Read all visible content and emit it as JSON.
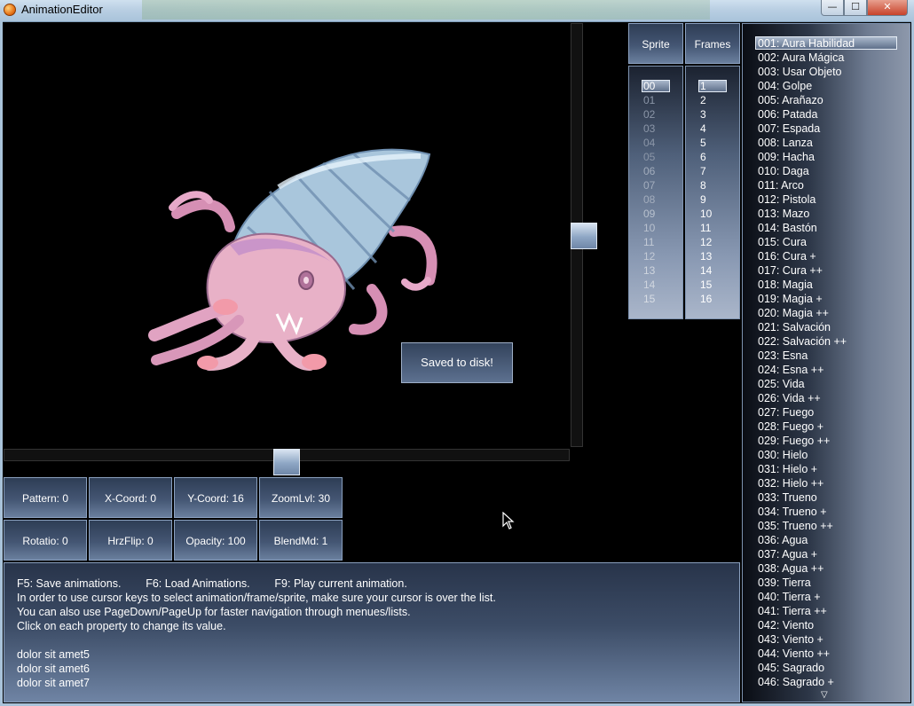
{
  "window": {
    "title": "AnimationEditor",
    "buttons": {
      "minimize": "—",
      "maximize": "☐",
      "close": "✕"
    }
  },
  "popup": {
    "message": "Saved to disk!"
  },
  "column_headers": {
    "sprite": "Sprite",
    "frames": "Frames"
  },
  "sprite_list": {
    "selected": "00",
    "items": [
      "00",
      "01",
      "02",
      "03",
      "04",
      "05",
      "06",
      "07",
      "08",
      "09",
      "10",
      "11",
      "12",
      "13",
      "14",
      "15"
    ]
  },
  "frame_list": {
    "selected": "1",
    "items": [
      "1",
      "2",
      "3",
      "4",
      "5",
      "6",
      "7",
      "8",
      "9",
      "10",
      "11",
      "12",
      "13",
      "14",
      "15",
      "16"
    ]
  },
  "properties": {
    "pattern": "Pattern: 0",
    "x_coord": "X-Coord: 0",
    "y_coord": "Y-Coord: 16",
    "zoom": "ZoomLvl: 30",
    "rotation": "Rotatio: 0",
    "hrz_flip": "HrzFlip: 0",
    "opacity": "Opacity: 100",
    "blend": "BlendMd: 1"
  },
  "info": {
    "line1": "F5: Save animations.        F6: Load Animations.        F9: Play current animation.",
    "line2": "In order to use cursor keys to select animation/frame/sprite, make sure your cursor is over the list.",
    "line3": "You can also use PageDown/PageUp for faster navigation through menues/lists.",
    "line4": "Click on each property to change its value.",
    "line5": "dolor sit amet5",
    "line6": "dolor sit amet6",
    "line7": "dolor sit amet7"
  },
  "animations": {
    "selected": "001: Aura Habilidad",
    "items": [
      "001: Aura Habilidad",
      "002: Aura Mágica",
      "003: Usar Objeto",
      "004: Golpe",
      "005: Arañazo",
      "006: Patada",
      "007: Espada",
      "008: Lanza",
      "009: Hacha",
      "010: Daga",
      "011: Arco",
      "012: Pistola",
      "013: Mazo",
      "014: Bastón",
      "015: Cura",
      "016: Cura +",
      "017: Cura ++",
      "018: Magia",
      "019: Magia +",
      "020: Magia ++",
      "021: Salvación",
      "022: Salvación ++",
      "023: Esna",
      "024: Esna ++",
      "025: Vida",
      "026: Vida ++",
      "027: Fuego",
      "028: Fuego +",
      "029: Fuego ++",
      "030: Hielo",
      "031: Hielo +",
      "032: Hielo ++",
      "033: Trueno",
      "034: Trueno +",
      "035: Trueno ++",
      "036: Agua",
      "037: Agua +",
      "038: Agua ++",
      "039: Tierra",
      "040: Tierra +",
      "041: Tierra ++",
      "042: Viento",
      "043: Viento +",
      "044: Viento ++",
      "045: Sagrado",
      "046: Sagrado +"
    ]
  }
}
